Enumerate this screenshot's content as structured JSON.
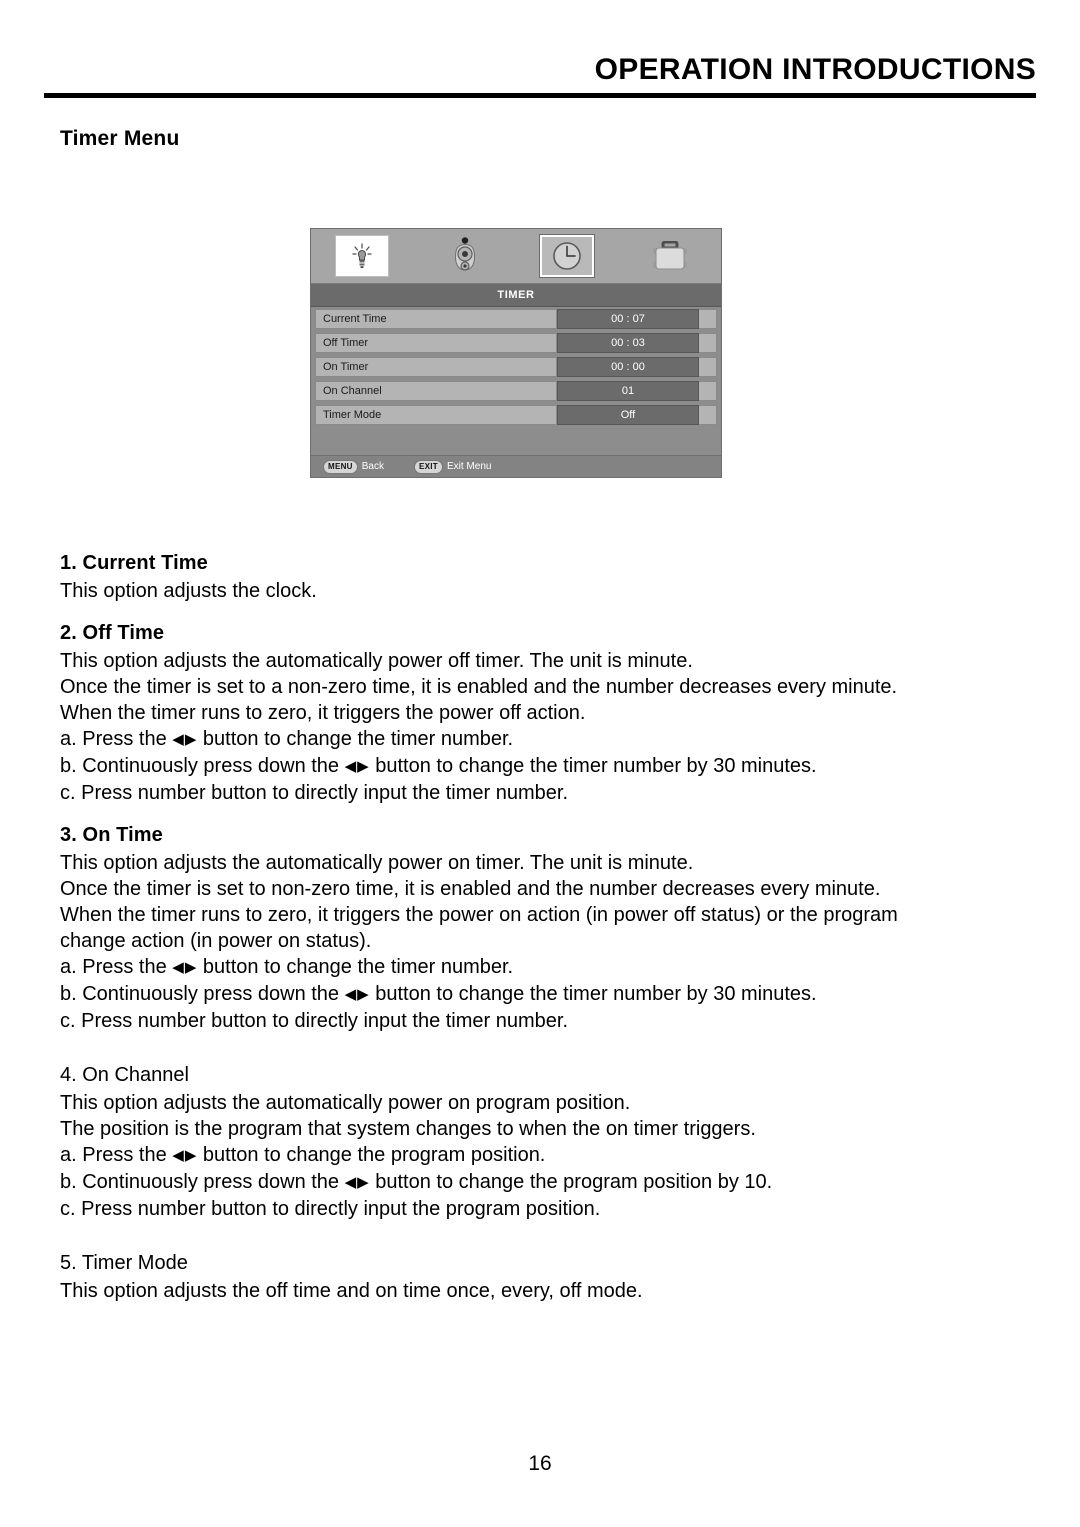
{
  "header": {
    "title": "OPERATION INTRODUCTIONS"
  },
  "section_heading": "Timer Menu",
  "osd": {
    "tabs": [
      {
        "name": "picture-icon",
        "label": "Picture"
      },
      {
        "name": "sound-icon",
        "label": "Sound"
      },
      {
        "name": "clock-icon",
        "label": "Timer"
      },
      {
        "name": "toolbox-icon",
        "label": "Function"
      }
    ],
    "selected_tab_index": 2,
    "title": "TIMER",
    "rows": [
      {
        "label": "Current Time",
        "value": "00 : 07"
      },
      {
        "label": "Off Timer",
        "value": "00 : 03"
      },
      {
        "label": "On Timer",
        "value": "00 : 00"
      },
      {
        "label": "On Channel",
        "value": "01"
      },
      {
        "label": "Timer Mode",
        "value": "Off"
      }
    ],
    "footer": {
      "menu_key": "MENU",
      "menu_action": "Back",
      "exit_key": "EXIT",
      "exit_action": "Exit Menu"
    }
  },
  "sections": {
    "s1": {
      "heading": "1. Current Time",
      "line1": "This option adjusts the clock."
    },
    "s2": {
      "heading": "2. Off Time",
      "line1": "This option adjusts the automatically power off timer. The unit is minute.",
      "line2": "Once the timer is set to a non-zero time, it is enabled and the number decreases every minute.",
      "line3": "When the timer runs to zero, it triggers the power off action.",
      "a_pre": "a. Press the ",
      "a_post": " button to change the timer number.",
      "b_pre": "b. Continuously press down the ",
      "b_post": " button to change the timer number by 30 minutes.",
      "c": "c. Press number button to directly input the timer number."
    },
    "s3": {
      "heading": "3. On Time",
      "line1": "This option adjusts the automatically power on timer. The unit is minute.",
      "line2": "Once the timer is set to non-zero time, it is enabled and the number decreases every minute.",
      "line3": "When the timer runs to zero, it triggers the power on action (in power off status) or the program",
      "line4": "change action (in power on status).",
      "a_pre": "a. Press the ",
      "a_post": " button to change the timer number.",
      "b_pre": "b. Continuously press down the ",
      "b_post": " button to change the timer number by 30 minutes.",
      "c": "c. Press number button to directly input the timer number."
    },
    "s4": {
      "heading": "4. On Channel",
      "line1": "This option adjusts the automatically power on program position.",
      "line2": "The position is the program that system changes to when the on timer triggers.",
      "a_pre": "a. Press the ",
      "a_post": " button to change the program position.",
      "b_pre": "b. Continuously press down the ",
      "b_post": " button to change the program position by 10.",
      "c": "c. Press number button to directly input the program position."
    },
    "s5": {
      "heading": "5. Timer Mode",
      "line1": "This option adjusts the off time and on time once, every, off mode."
    }
  },
  "arrows_glyph": "◀▶",
  "page_number": "16"
}
